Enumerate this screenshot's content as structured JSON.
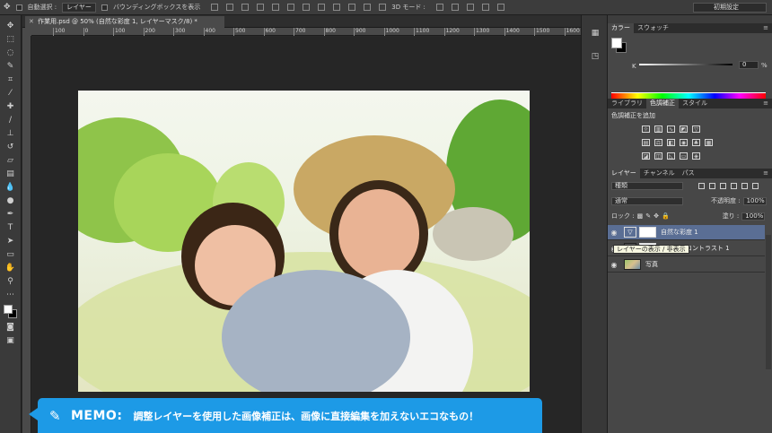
{
  "options_bar": {
    "auto_select_label": "自動選択 :",
    "auto_select_value": "レイヤー",
    "bounding_box_label": "バウンディングボックスを表示",
    "mode_3d_label": "3D モード :",
    "workspace": "初期設定"
  },
  "document_tab": {
    "title": "作業用.psd @ 50% (自然な彩度 1, レイヤーマスク/8) *"
  },
  "ruler": {
    "ticks": [
      "100",
      "0",
      "100",
      "200",
      "300",
      "400",
      "500",
      "600",
      "700",
      "800",
      "900",
      "1000",
      "1100",
      "1200",
      "1300",
      "1400",
      "1500",
      "1600",
      "1700"
    ]
  },
  "color_panel": {
    "tabs": [
      "カラー",
      "スウォッチ"
    ],
    "k_label": "K",
    "k_value": "0",
    "k_unit": "%"
  },
  "adjustments_panel": {
    "tabs": [
      "ライブラリ",
      "色調補正",
      "スタイル"
    ],
    "title": "色調補正を追加"
  },
  "layers_panel": {
    "tabs": [
      "レイヤー",
      "チャンネル",
      "パス"
    ],
    "filter_kind": "種類",
    "blend_mode": "通常",
    "opacity_label": "不透明度 :",
    "opacity_value": "100%",
    "lock_label": "ロック :",
    "fill_label": "塗り :",
    "fill_value": "100%",
    "layers": [
      {
        "name": "自然な彩度 1",
        "selected": true
      },
      {
        "name": "明るさ・コントラスト 1",
        "selected": false
      },
      {
        "name": "写真",
        "selected": false
      }
    ],
    "tooltip": "レイヤーの表示 / 非表示"
  },
  "memo": {
    "label": "MEMO:",
    "text": "調整レイヤーを使用した画像補正は、画像に直接編集を加えないエコなもの！"
  },
  "colors": {
    "memo_blue": "#1d9ae6",
    "selected_layer": "#5a6e94",
    "panel_bg": "#474747"
  }
}
